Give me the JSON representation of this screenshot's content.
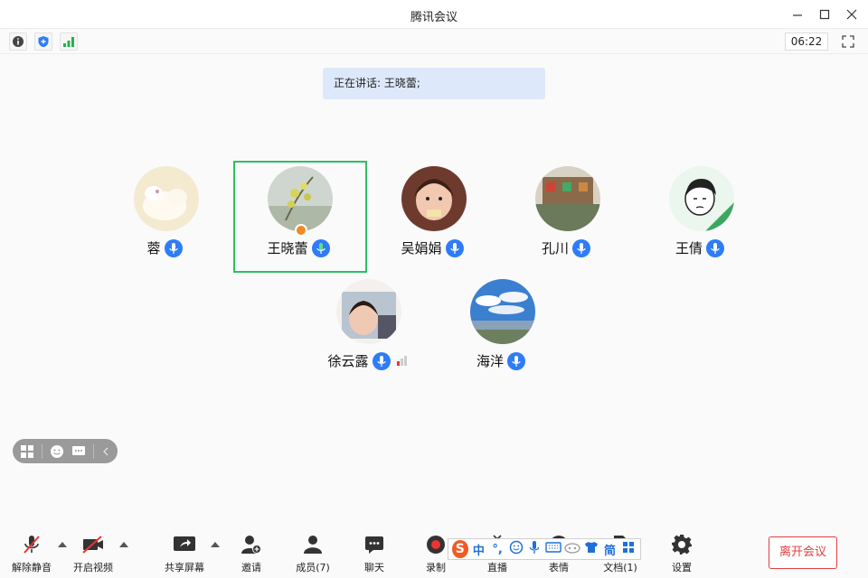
{
  "window": {
    "title": "腾讯会议"
  },
  "infobar": {
    "timer": "06:22"
  },
  "speaking": {
    "text": "正在讲话: 王晓蕾;"
  },
  "participants": [
    {
      "name": "蓉"
    },
    {
      "name": "王晓蕾"
    },
    {
      "name": "吴娟娟"
    },
    {
      "name": "孔川"
    },
    {
      "name": "王倩"
    },
    {
      "name": "徐云露"
    },
    {
      "name": "海洋"
    }
  ],
  "toolbar": {
    "unmute": "解除静音",
    "video": "开启视频",
    "share": "共享屏幕",
    "invite": "邀请",
    "members": "成员(7)",
    "chat": "聊天",
    "record": "录制",
    "live": "直播",
    "emoji": "表情",
    "docs": "文档(1)",
    "settings": "设置",
    "leave": "离开会议"
  },
  "ime": {
    "mode": "中",
    "punct": "°,",
    "simp": "简",
    "logo": "S"
  },
  "colors": {
    "accent": "#2e7cf6",
    "active_border": "#2fbf63",
    "leave": "#e04040",
    "speaking_bg": "#dde9fb"
  }
}
